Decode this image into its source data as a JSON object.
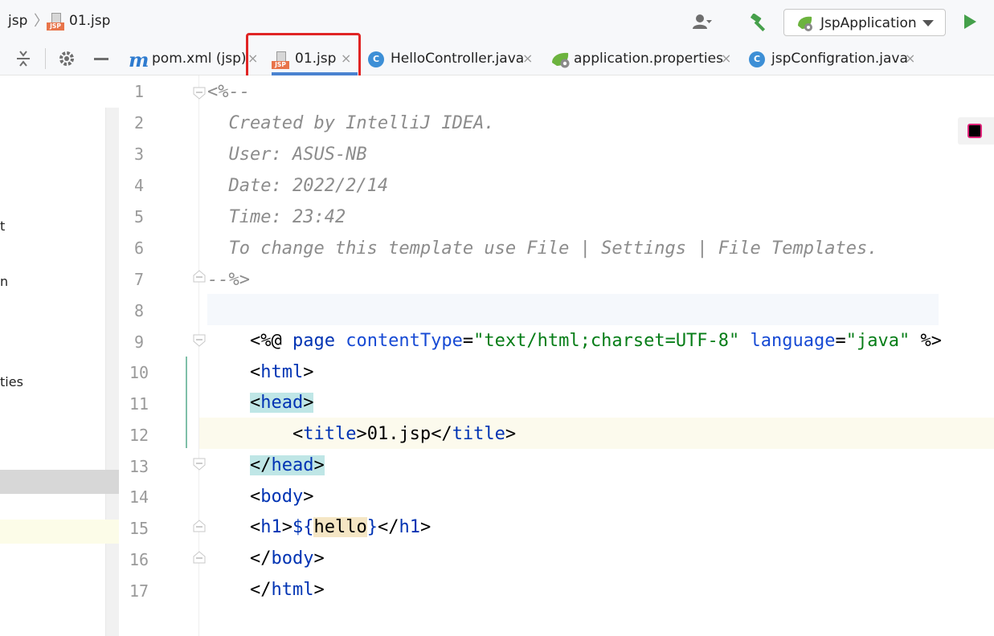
{
  "breadcrumb": {
    "project": "jsp",
    "file": "01.jsp",
    "file_icon_tag": "JSP"
  },
  "run_config": {
    "label": "JspApplication"
  },
  "tabs": [
    {
      "label": "pom.xml (jsp)",
      "icon": "maven-icon",
      "icon_text": "m"
    },
    {
      "label": "01.jsp",
      "icon": "jsp-file-icon",
      "icon_text": "JSP",
      "active": true
    },
    {
      "label": "HelloController.java",
      "icon": "java-class-icon",
      "icon_text": "C"
    },
    {
      "label": "application.properties",
      "icon": "spring-properties-icon"
    },
    {
      "label": "jspConfigration.java",
      "icon": "java-class-icon",
      "icon_text": "C"
    }
  ],
  "close_glyph": "×",
  "project_panel": {
    "fragments": [
      "t",
      "n",
      "ties"
    ]
  },
  "editor": {
    "line_numbers": [
      "1",
      "2",
      "3",
      "4",
      "5",
      "6",
      "7",
      "8",
      "9",
      "10",
      "11",
      "12",
      "13",
      "14",
      "15",
      "16",
      "17"
    ],
    "code": {
      "l1": "<%--",
      "l2": "  Created by IntelliJ IDEA.",
      "l3": "  User: ASUS-NB",
      "l4": "  Date: 2022/2/14",
      "l5": "  Time: 23:42",
      "l6": "  To change this template use File | Settings | File Templates.",
      "l7": "--%>",
      "l8_open": "<%@ ",
      "l8_page": "page ",
      "l8_attr1": "contentType",
      "l8_eq1": "=",
      "l8_val1": "\"text/html;charset=UTF-8\"",
      "l8_attr2": " language",
      "l8_eq2": "=",
      "l8_val2": "\"java\"",
      "l8_close": " %>",
      "l9_lt": "<",
      "l9_tag": "html",
      "l9_gt": ">",
      "l10_lt": "<",
      "l10_tag": "head",
      "l10_gt": ">",
      "l11_indent": "    ",
      "l11_lt": "<",
      "l11_tag": "title",
      "l11_gt": ">",
      "l11_text": "01.jsp",
      "l11_lt2": "</",
      "l11_tag2": "title",
      "l11_gt2": ">",
      "l12_lt": "</",
      "l12_tag": "head",
      "l12_gt": ">",
      "l13_lt": "<",
      "l13_tag": "body",
      "l13_gt": ">",
      "l14_lt": "<",
      "l14_tag": "h1",
      "l14_gt": ">",
      "l14_el_open": "${",
      "l14_var": "hello",
      "l14_el_close": "}",
      "l14_lt2": "</",
      "l14_tag2": "h1",
      "l14_gt2": ">",
      "l15_lt": "</",
      "l15_tag": "body",
      "l15_gt": ">",
      "l16_lt": "</",
      "l16_tag": "html",
      "l16_gt": ">"
    }
  }
}
